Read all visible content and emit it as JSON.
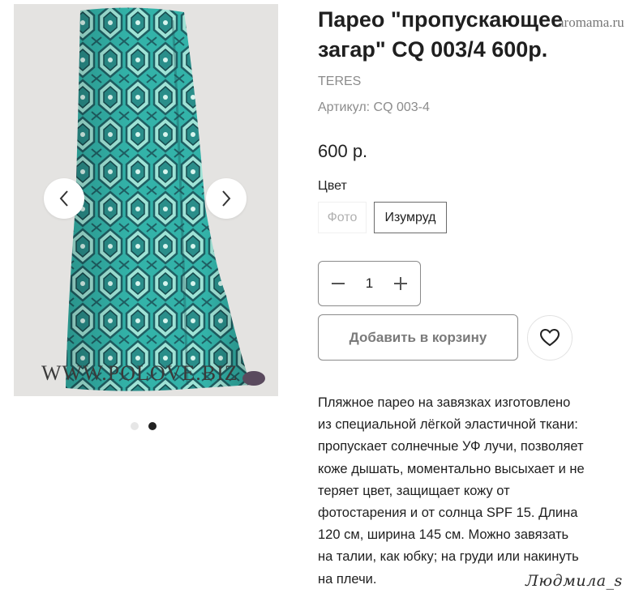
{
  "product": {
    "title": "Парео \"пропускающее загар\" CQ 003/4 600р.",
    "brand": "TERES",
    "sku": "Артикул: CQ 003-4",
    "price": "600 р.",
    "color_label": "Цвет",
    "color_options": [
      {
        "label": "Фото",
        "selected": false
      },
      {
        "label": "Изумруд",
        "selected": true
      }
    ],
    "quantity": "1",
    "add_to_cart_label": "Добавить в корзину",
    "description": "Пляжное парео на завязках изготовлено из специальной лёгкой эластичной ткани: пропускает солнечные УФ лучи, позволяет коже дышать, моментально высыхает и не теряет цвет, защищает кожу от фотостарения и от солнца SPF 15. Длина 120 см, ширина 145 см. Можно завязать на талии, как юбку; на груди или накинуть на плечи."
  },
  "gallery": {
    "photo_watermark": "WWW.POLOVE.BIZ",
    "slide_count": 2,
    "active_slide": 2
  },
  "overlays": {
    "corner_watermark": "aromama.ru",
    "signature": "Людмила_s"
  },
  "icons": {
    "prev": "chevron-left-icon",
    "next": "chevron-right-icon",
    "decrement": "minus-icon",
    "increment": "plus-icon",
    "wishlist": "heart-icon"
  },
  "colors": {
    "fabric_teal": "#2aa8a0",
    "fabric_dark": "#1f5f63",
    "photo_background": "#e4e3e1",
    "muted_text": "#8c8c8c"
  }
}
